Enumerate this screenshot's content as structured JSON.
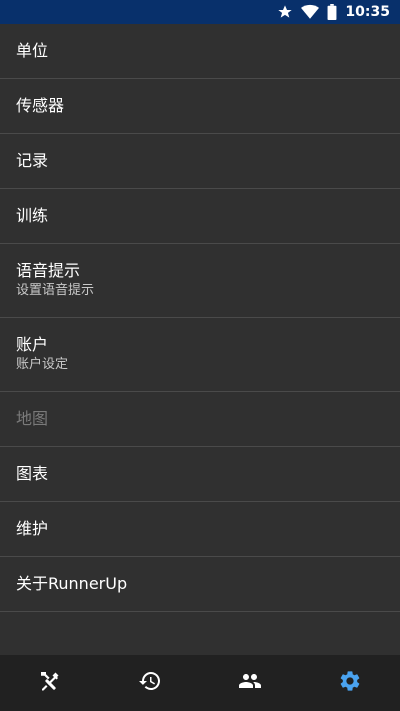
{
  "status_bar": {
    "time": "10:35",
    "icons": [
      "star-icon",
      "wifi-icon",
      "battery-icon"
    ]
  },
  "settings": {
    "items": [
      {
        "title": "单位"
      },
      {
        "title": "传感器"
      },
      {
        "title": "记录"
      },
      {
        "title": "训练"
      },
      {
        "title": "语音提示",
        "summary": "设置语音提示"
      },
      {
        "title": "账户",
        "summary": "账户设定"
      },
      {
        "title": "地图",
        "disabled": true
      },
      {
        "title": "图表"
      },
      {
        "title": "维护"
      },
      {
        "title": "关于RunnerUp"
      }
    ]
  },
  "bottom_nav": {
    "tabs": [
      {
        "icon": "tools-icon",
        "active": false
      },
      {
        "icon": "history-icon",
        "active": false
      },
      {
        "icon": "people-icon",
        "active": false
      },
      {
        "icon": "gear-icon",
        "active": true
      }
    ],
    "active_color": "#4aa3f0",
    "inactive_color": "#ffffff"
  }
}
